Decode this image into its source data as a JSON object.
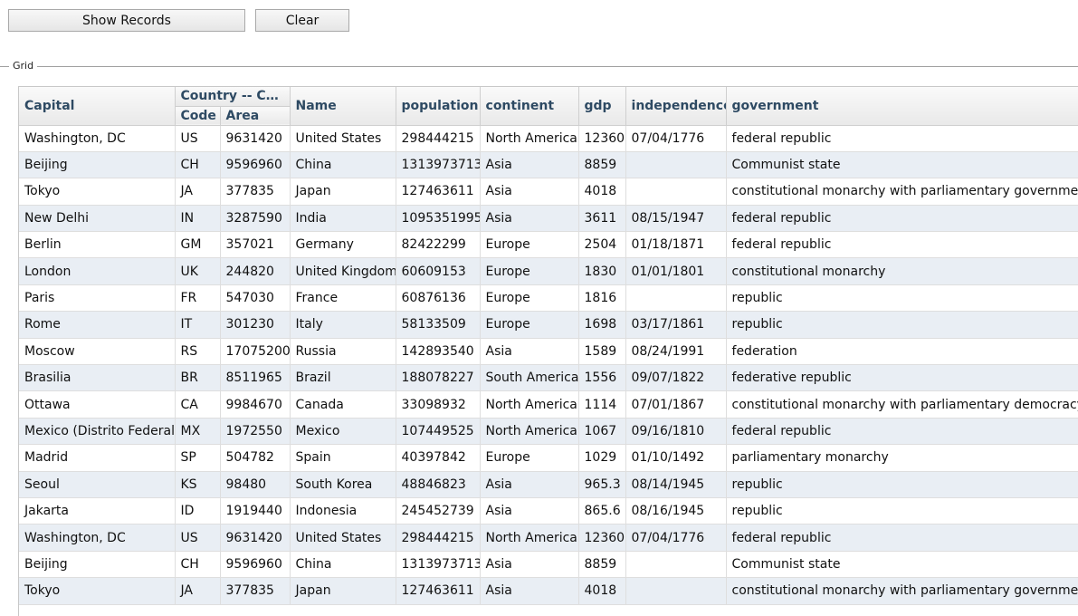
{
  "toolbar": {
    "show_records_label": "Show Records",
    "clear_label": "Clear"
  },
  "group": {
    "legend": "Grid"
  },
  "grid": {
    "headers": {
      "capital": "Capital",
      "country_group": "Country -- Code and Area",
      "code": "Code",
      "area": "Area",
      "name": "Name",
      "population": "population",
      "continent": "continent",
      "gdp": "gdp",
      "independence": "independence",
      "government": "government"
    },
    "rows": [
      {
        "capital": "Washington, DC",
        "code": "US",
        "area": "9631420",
        "name": "United States",
        "population": "298444215",
        "continent": "North America",
        "gdp": "12360",
        "independence": "07/04/1776",
        "government": "federal republic"
      },
      {
        "capital": "Beijing",
        "code": "CH",
        "area": "9596960",
        "name": "China",
        "population": "1313973713",
        "continent": "Asia",
        "gdp": "8859",
        "independence": "",
        "government": "Communist state"
      },
      {
        "capital": "Tokyo",
        "code": "JA",
        "area": "377835",
        "name": "Japan",
        "population": "127463611",
        "continent": "Asia",
        "gdp": "4018",
        "independence": "",
        "government": "constitutional monarchy with parliamentary government"
      },
      {
        "capital": "New Delhi",
        "code": "IN",
        "area": "3287590",
        "name": "India",
        "population": "1095351995",
        "continent": "Asia",
        "gdp": "3611",
        "independence": "08/15/1947",
        "government": "federal republic"
      },
      {
        "capital": "Berlin",
        "code": "GM",
        "area": "357021",
        "name": "Germany",
        "population": "82422299",
        "continent": "Europe",
        "gdp": "2504",
        "independence": "01/18/1871",
        "government": "federal republic"
      },
      {
        "capital": "London",
        "code": "UK",
        "area": "244820",
        "name": "United Kingdom",
        "population": "60609153",
        "continent": "Europe",
        "gdp": "1830",
        "independence": "01/01/1801",
        "government": "constitutional monarchy"
      },
      {
        "capital": "Paris",
        "code": "FR",
        "area": "547030",
        "name": "France",
        "population": "60876136",
        "continent": "Europe",
        "gdp": "1816",
        "independence": "",
        "government": "republic"
      },
      {
        "capital": "Rome",
        "code": "IT",
        "area": "301230",
        "name": "Italy",
        "population": "58133509",
        "continent": "Europe",
        "gdp": "1698",
        "independence": "03/17/1861",
        "government": "republic"
      },
      {
        "capital": "Moscow",
        "code": "RS",
        "area": "17075200",
        "name": "Russia",
        "population": "142893540",
        "continent": "Asia",
        "gdp": "1589",
        "independence": "08/24/1991",
        "government": "federation"
      },
      {
        "capital": "Brasilia",
        "code": "BR",
        "area": "8511965",
        "name": "Brazil",
        "population": "188078227",
        "continent": "South America",
        "gdp": "1556",
        "independence": "09/07/1822",
        "government": "federative republic"
      },
      {
        "capital": "Ottawa",
        "code": "CA",
        "area": "9984670",
        "name": "Canada",
        "population": "33098932",
        "continent": "North America",
        "gdp": "1114",
        "independence": "07/01/1867",
        "government": "constitutional monarchy with parliamentary democracy and"
      },
      {
        "capital": "Mexico (Distrito Federal)",
        "code": "MX",
        "area": "1972550",
        "name": "Mexico",
        "population": "107449525",
        "continent": "North America",
        "gdp": "1067",
        "independence": "09/16/1810",
        "government": "federal republic"
      },
      {
        "capital": "Madrid",
        "code": "SP",
        "area": "504782",
        "name": "Spain",
        "population": "40397842",
        "continent": "Europe",
        "gdp": "1029",
        "independence": "01/10/1492",
        "government": "parliamentary monarchy"
      },
      {
        "capital": "Seoul",
        "code": "KS",
        "area": "98480",
        "name": "South Korea",
        "population": "48846823",
        "continent": "Asia",
        "gdp": "965.3",
        "independence": "08/14/1945",
        "government": "republic"
      },
      {
        "capital": "Jakarta",
        "code": "ID",
        "area": "1919440",
        "name": "Indonesia",
        "population": "245452739",
        "continent": "Asia",
        "gdp": "865.6",
        "independence": "08/16/1945",
        "government": "republic"
      },
      {
        "capital": "Washington, DC",
        "code": "US",
        "area": "9631420",
        "name": "United States",
        "population": "298444215",
        "continent": "North America",
        "gdp": "12360",
        "independence": "07/04/1776",
        "government": "federal republic"
      },
      {
        "capital": "Beijing",
        "code": "CH",
        "area": "9596960",
        "name": "China",
        "population": "1313973713",
        "continent": "Asia",
        "gdp": "8859",
        "independence": "",
        "government": "Communist state"
      },
      {
        "capital": "Tokyo",
        "code": "JA",
        "area": "377835",
        "name": "Japan",
        "population": "127463611",
        "continent": "Asia",
        "gdp": "4018",
        "independence": "",
        "government": "constitutional monarchy with parliamentary government"
      }
    ]
  }
}
